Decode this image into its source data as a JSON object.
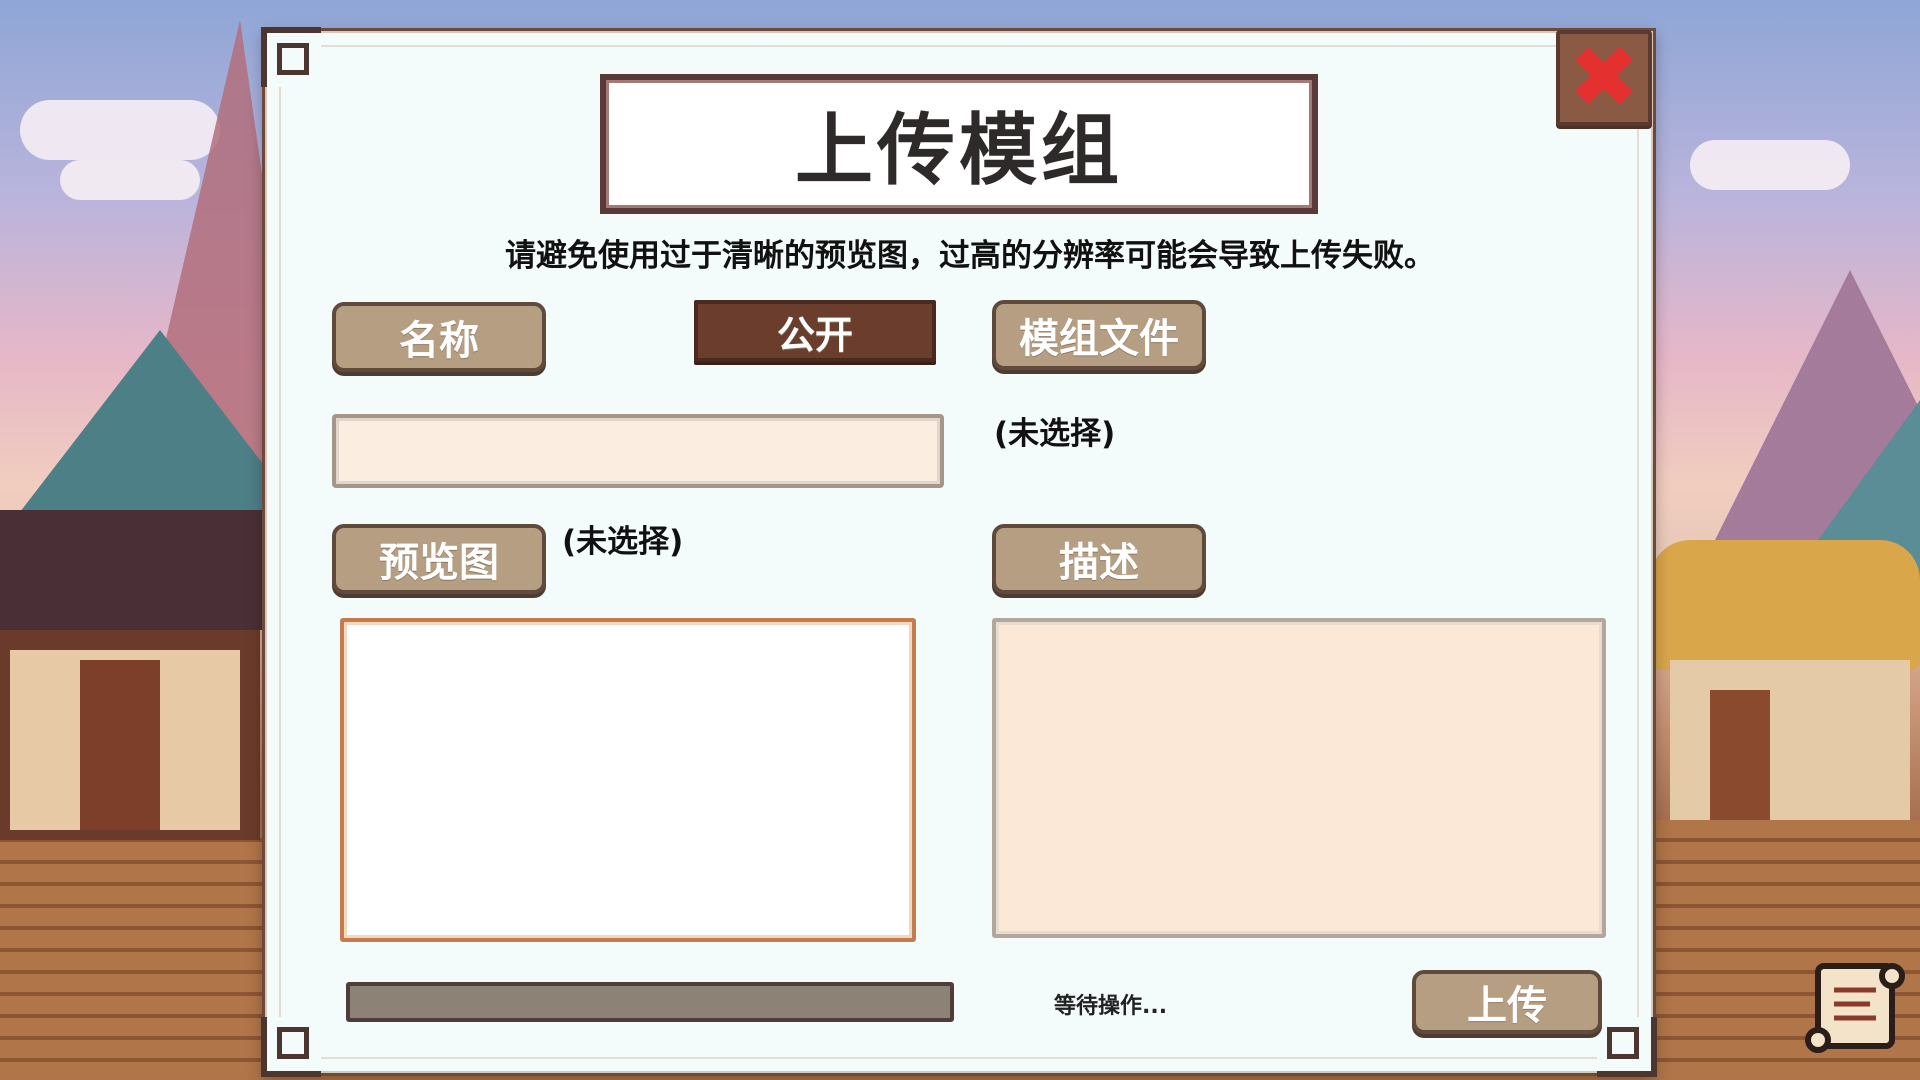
{
  "dialog": {
    "title": "上传模组",
    "notice": "请避免使用过于清晰的预览图，过高的分辨率可能会导致上传失败。",
    "close_icon": "close-x-icon"
  },
  "buttons": {
    "name": "名称",
    "public": "公开",
    "mod_file": "模组文件",
    "preview": "预览图",
    "description": "描述",
    "upload": "上传"
  },
  "fields": {
    "name_value": "",
    "mod_file_status": "(未选择)",
    "preview_status": "(未选择)",
    "description_value": ""
  },
  "progress": {
    "value": 0,
    "status_text": "等待操作..."
  },
  "colors": {
    "button": "#b69e82",
    "button_dark": "#6b3d2c",
    "close": "#e53030"
  },
  "icons": {
    "corner": "ornament-corner-icon",
    "scroll": "scroll-icon"
  }
}
